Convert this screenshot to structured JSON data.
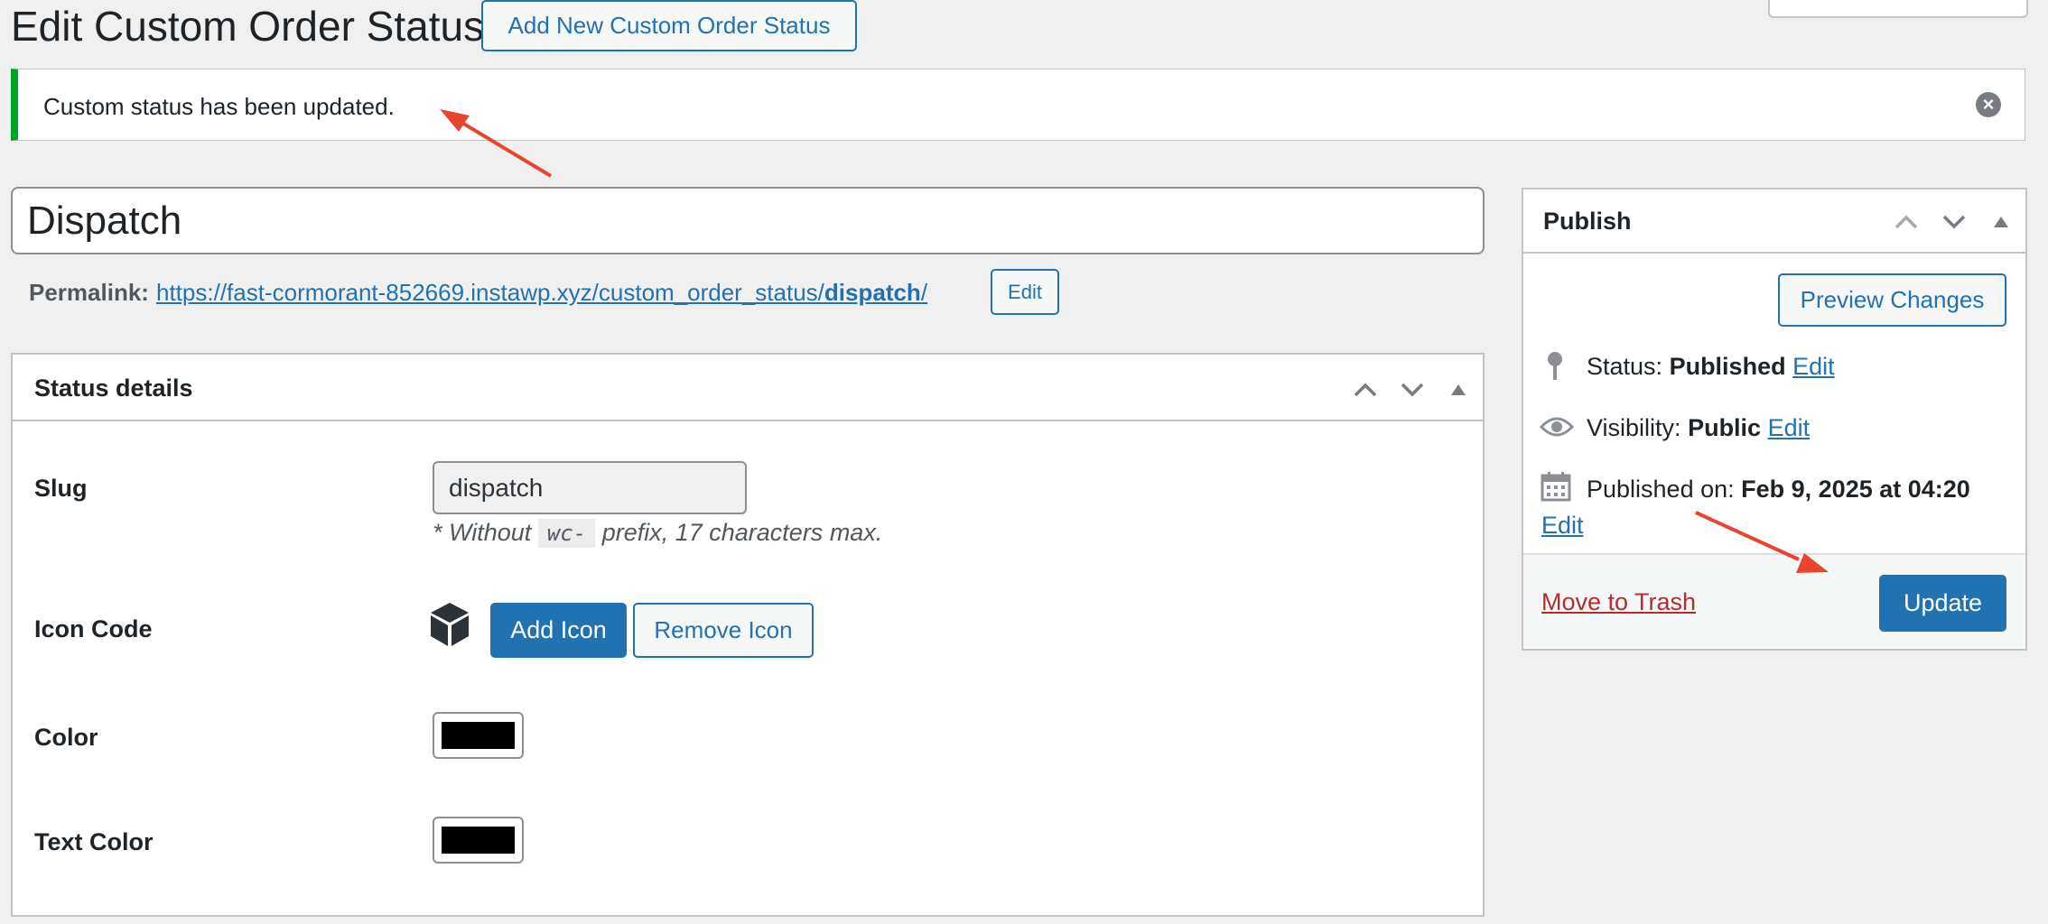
{
  "header": {
    "title": "Edit Custom Order Status",
    "add_new_label": "Add New Custom Order Status"
  },
  "notice": {
    "message": "Custom status has been updated.",
    "accent_color": "#00a32a"
  },
  "post": {
    "title_value": "Dispatch",
    "permalink_label": "Permalink:",
    "permalink_base": "https://fast-cormorant-852669.instawp.xyz/custom_order_status/",
    "permalink_slug": "dispatch",
    "permalink_trailing": "/",
    "permalink_edit": "Edit"
  },
  "status_details": {
    "title": "Status details",
    "slug": {
      "label": "Slug",
      "value": "dispatch",
      "desc_before": "* Without",
      "desc_code": "wc-",
      "desc_after": "prefix, 17 characters max."
    },
    "icon_code": {
      "label": "Icon Code",
      "icon": "cube-icon",
      "add_label": "Add Icon",
      "remove_label": "Remove Icon"
    },
    "color": {
      "label": "Color",
      "value": "#000000"
    },
    "text_color": {
      "label": "Text Color",
      "value": "#000000"
    }
  },
  "publish": {
    "title": "Publish",
    "preview_label": "Preview Changes",
    "status_label": "Status:",
    "status_value": "Published",
    "visibility_label": "Visibility:",
    "visibility_value": "Public",
    "published_label": "Published on:",
    "published_value": "Feb 9, 2025 at 04:20",
    "edit_label": "Edit",
    "trash_label": "Move to Trash",
    "update_label": "Update"
  },
  "colors": {
    "primary": "#2271b1",
    "danger": "#b32d2e",
    "annotation_arrow": "#e8442e"
  }
}
